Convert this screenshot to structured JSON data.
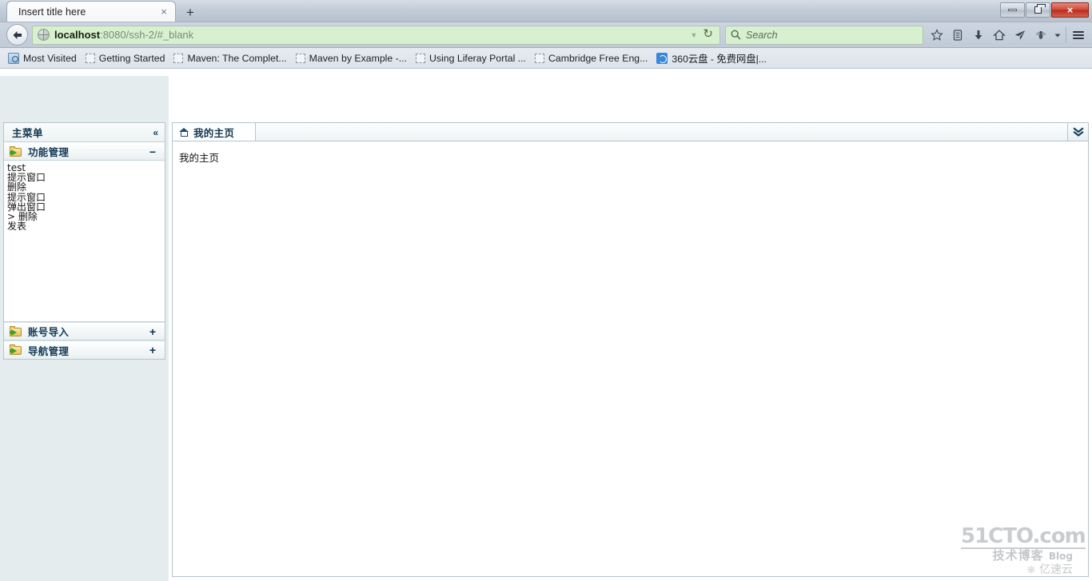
{
  "browser": {
    "tab": {
      "title": "Insert title here",
      "close_label": "×"
    },
    "newtab_label": "+",
    "window_controls": {
      "minimize": "minimize-icon",
      "restore": "restore-icon",
      "close": "×"
    },
    "nav": {
      "back_icon": "back-arrow-icon",
      "url_prefix": "localhost",
      "url_suffix": ":8080/ssh-2/#_blank",
      "url_full": "localhost:8080/ssh-2/#_blank",
      "url_dropdown_icon": "chevron-down-icon",
      "reload_icon": "reload-icon"
    },
    "search": {
      "placeholder": "Search",
      "icon": "search-icon"
    },
    "toolbar_icons": [
      {
        "name": "bookmark-star-icon",
        "glyph": "☆"
      },
      {
        "name": "reading-list-icon",
        "glyph": "὜9"
      },
      {
        "name": "downloads-icon",
        "glyph": "↓"
      },
      {
        "name": "home-icon",
        "glyph": "⌂"
      },
      {
        "name": "send-page-icon",
        "glyph": "➤"
      },
      {
        "name": "firebug-icon",
        "glyph": "🐛"
      },
      {
        "name": "overflow-chevron-icon",
        "glyph": "▾"
      },
      {
        "name": "hamburger-menu-icon",
        "glyph": "☰"
      }
    ],
    "bookmarks": [
      {
        "label": "Most Visited",
        "icon": "most-visited-icon"
      },
      {
        "label": "Getting Started",
        "icon": "dashed-placeholder-icon"
      },
      {
        "label": "Maven: The Complet...",
        "icon": "dashed-placeholder-icon"
      },
      {
        "label": "Maven by Example -...",
        "icon": "dashed-placeholder-icon"
      },
      {
        "label": "Using Liferay Portal ...",
        "icon": "dashed-placeholder-icon"
      },
      {
        "label": "Cambridge Free Eng...",
        "icon": "dashed-placeholder-icon"
      },
      {
        "label": "360云盘 - 免费网盘|...",
        "icon": "cloud-disk-icon"
      }
    ]
  },
  "sidebar": {
    "title": "主菜单",
    "collapse_icon": "«",
    "panels": [
      {
        "label": "功能管理",
        "icon": "folder-arrow-icon",
        "toggle": "−",
        "expanded": true,
        "items": [
          "test",
          "提示窗口",
          "删除",
          "提示窗口",
          "弹出窗口",
          "> 删除",
          "发表"
        ]
      },
      {
        "label": "账号导入",
        "icon": "folder-arrow-icon",
        "toggle": "+",
        "expanded": false,
        "items": []
      },
      {
        "label": "导航管理",
        "icon": "folder-arrow-icon",
        "toggle": "+",
        "expanded": false,
        "items": []
      }
    ]
  },
  "main": {
    "tabs": [
      {
        "label": "我的主页",
        "icon": "home-icon",
        "active": true
      }
    ],
    "more_tabs_icon": "double-chevron-down-icon",
    "body_text": "我的主页"
  },
  "watermark": {
    "line1": "51CTO.com",
    "line2": "技术博客",
    "blog": "Blog",
    "line3": "亿速云"
  },
  "colors": {
    "url_bar_bg": "#d7f0cf",
    "page_bg": "#e5ecee",
    "panel_border": "#b4c4cb",
    "heading_text": "#10354f"
  }
}
